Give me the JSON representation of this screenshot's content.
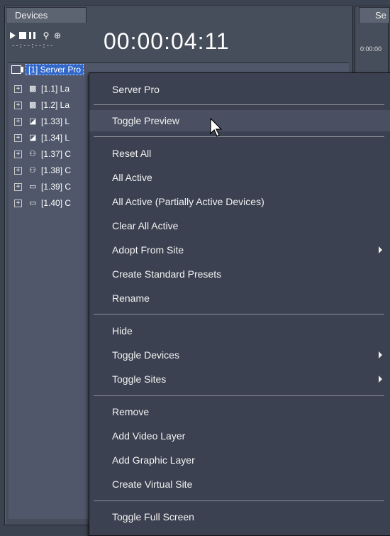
{
  "panel": {
    "tab_label": "Devices",
    "right_tab_label": "Se",
    "timecode": "00:00:04:11",
    "small_timecode": "--:--:--:--",
    "right_timecode": "0:00:00"
  },
  "tree": {
    "root_label": "[1] Server Pro",
    "items": [
      {
        "label": "[1.1] La",
        "icon": "layer-icon"
      },
      {
        "label": "[1.2] La",
        "icon": "layer-icon"
      },
      {
        "label": "[1.33] L",
        "icon": "image-layer-icon"
      },
      {
        "label": "[1.34] L",
        "icon": "image-layer-icon"
      },
      {
        "label": "[1.37] C",
        "icon": "camera-icon"
      },
      {
        "label": "[1.38] C",
        "icon": "camera-icon"
      },
      {
        "label": "[1.39] C",
        "icon": "monitor-icon"
      },
      {
        "label": "[1.40] C",
        "icon": "monitor-icon"
      }
    ]
  },
  "context_menu": {
    "header": "Server Pro",
    "items": {
      "toggle_preview": "Toggle Preview",
      "reset_all": "Reset All",
      "all_active": "All Active",
      "all_active_partial": "All Active (Partially Active Devices)",
      "clear_all_active": "Clear All Active",
      "adopt_from_site": "Adopt From Site",
      "create_standard_presets": "Create Standard Presets",
      "rename": "Rename",
      "hide": "Hide",
      "toggle_devices": "Toggle Devices",
      "toggle_sites": "Toggle Sites",
      "remove": "Remove",
      "add_video_layer": "Add Video Layer",
      "add_graphic_layer": "Add Graphic Layer",
      "create_virtual_site": "Create Virtual Site",
      "toggle_full_screen": "Toggle Full Screen"
    }
  }
}
